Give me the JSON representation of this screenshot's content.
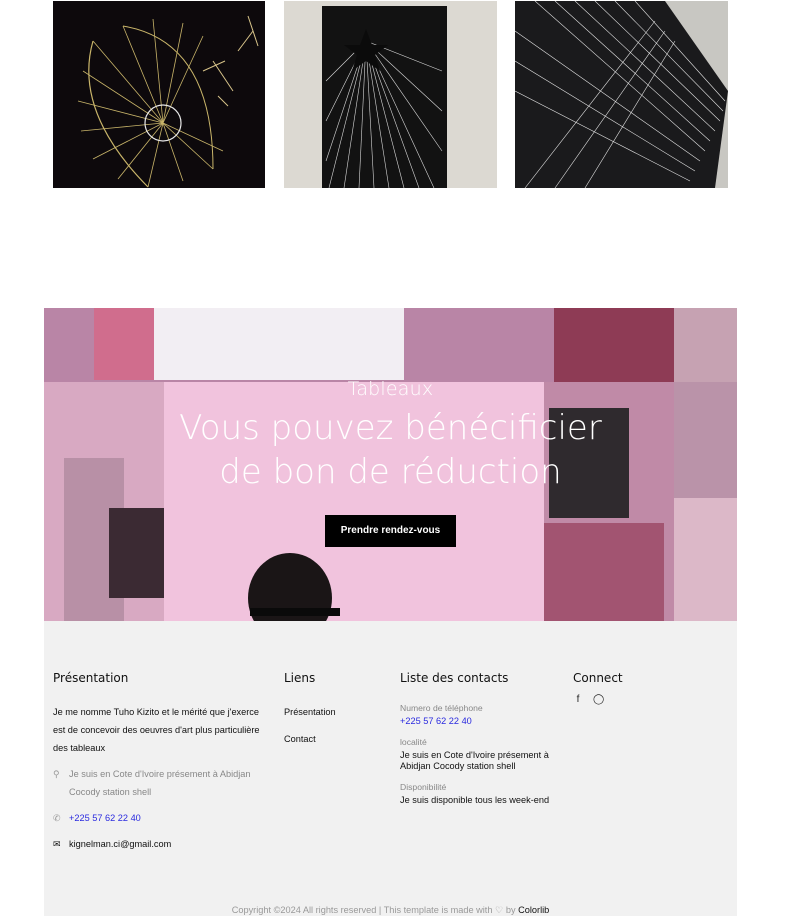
{
  "gallery": {
    "images": [
      {
        "name": "string-art-spiral",
        "alt": "spiral string art"
      },
      {
        "name": "string-art-star",
        "alt": "star string art"
      },
      {
        "name": "string-art-mesh",
        "alt": "mesh string art"
      }
    ]
  },
  "hero": {
    "subtitle": "Tableaux",
    "title_line1": "Vous pouvez bénécificier",
    "title_line2": "de bon de réduction",
    "button_label": "Prendre rendez-vous"
  },
  "footer": {
    "about": {
      "heading": "Présentation",
      "text": "Je me nomme Tuho Kizito et le mérité que j'exerce est de concevoir des oeuvres d'art plus particulière des tableaux",
      "address": "Je suis en Cote d'Ivoire présement à Abidjan Cocody station shell",
      "phone": "+225 57 62 22 40",
      "email": "kignelman.ci@gmail.com",
      "icons": {
        "address": "map-pin-icon",
        "phone": "phone-icon",
        "email": "envelope-icon"
      }
    },
    "links": {
      "heading": "Liens",
      "items": [
        "Présentation",
        "Contact"
      ]
    },
    "contacts": {
      "heading": "Liste des contacts",
      "phone_label": "Numero de téléphone",
      "phone_value": "+225 57 62 22 40",
      "location_label": "localité",
      "location_value": "Je suis en Cote d'Ivoire présement à Abidjan Cocody station shell",
      "availability_label": "Disponibilité",
      "availability_value": "Je suis disponible tous les week-end"
    },
    "connect": {
      "heading": "Connect",
      "icons": [
        "facebook-icon",
        "instagram-icon"
      ]
    },
    "copyright_text": "Copyright ©2024 All rights reserved | This template is made with",
    "copyright_by": "by",
    "copyright_brand": "Colorlib"
  },
  "colors": {
    "link": "#2a2adf",
    "footer_bg": "#f1f1f1",
    "button_bg": "#000000"
  }
}
